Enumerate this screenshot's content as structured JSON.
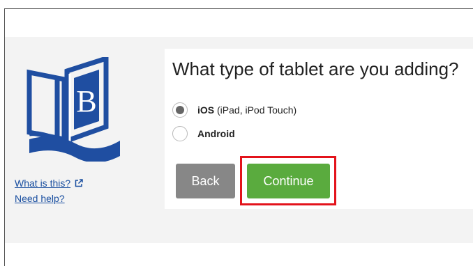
{
  "heading": "What type of tablet are you adding?",
  "options": [
    {
      "name": "iOS",
      "detail": "(iPad, iPod Touch)",
      "selected": true
    },
    {
      "name": "Android",
      "detail": "",
      "selected": false
    }
  ],
  "buttons": {
    "back": "Back",
    "continue": "Continue"
  },
  "links": {
    "what_is_this": "What is this?",
    "need_help": "Need help?"
  },
  "icons": {
    "logo": "open-book-logo",
    "external": "external-link-icon"
  },
  "colors": {
    "logo_blue": "#1f4ea1",
    "continue_green": "#5aab3e",
    "back_gray": "#878787",
    "highlight_red": "#e3131b",
    "link_blue": "#1a4fa0",
    "radio_selected": "#666666"
  }
}
